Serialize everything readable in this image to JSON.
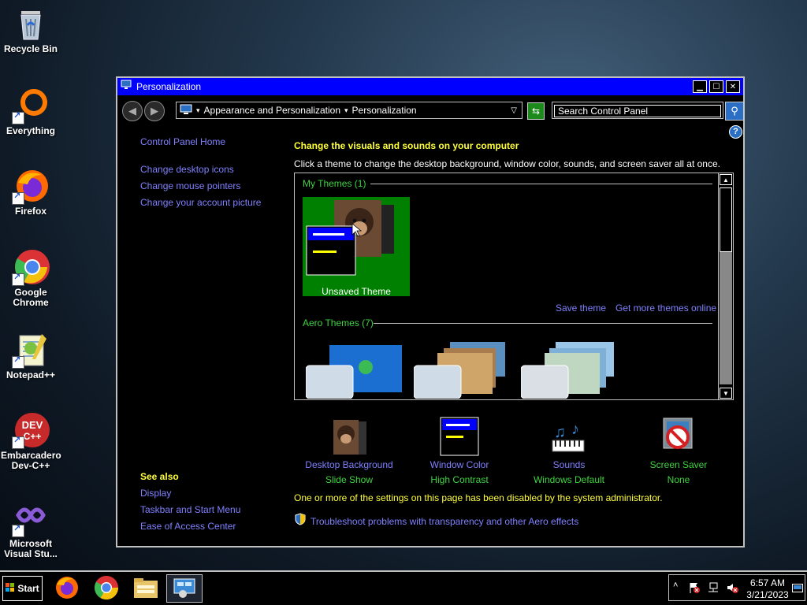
{
  "desktop": {
    "icons": [
      {
        "label": "Recycle Bin"
      },
      {
        "label": "Everything"
      },
      {
        "label": "Firefox"
      },
      {
        "label": "Google Chrome"
      },
      {
        "label": "Notepad++"
      },
      {
        "label": "Embarcadero Dev-C++"
      },
      {
        "label": "Microsoft Visual Stu..."
      }
    ]
  },
  "window": {
    "title": "Personalization",
    "address": {
      "crumb1": "Appearance and Personalization",
      "crumb2": "Personalization"
    },
    "search_placeholder": "Search Control Panel",
    "sidebar": {
      "home": "Control Panel Home",
      "links": [
        "Change desktop icons",
        "Change mouse pointers",
        "Change your account picture"
      ],
      "see_also_title": "See also",
      "see_also": [
        "Display",
        "Taskbar and Start Menu",
        "Ease of Access Center"
      ]
    },
    "main": {
      "heading": "Change the visuals and sounds on your computer",
      "subheading": "Click a theme to change the desktop background, window color, sounds, and screen saver all at once.",
      "my_themes": "My Themes (1)",
      "unsaved_theme": "Unsaved Theme",
      "save_theme": "Save theme",
      "get_more": "Get more themes online",
      "aero_themes": "Aero Themes (7)"
    },
    "settings": [
      {
        "label": "Desktop Background",
        "value": "Slide Show"
      },
      {
        "label": "Window Color",
        "value": "High Contrast"
      },
      {
        "label": "Sounds",
        "value": "Windows Default"
      },
      {
        "label": "Screen Saver",
        "value": "None"
      }
    ],
    "disabled_note": "One or more of the settings on this page has been disabled by the system administrator.",
    "troubleshoot": "Troubleshoot problems with transparency and other Aero effects"
  },
  "taskbar": {
    "start": "Start",
    "time": "6:57 AM",
    "date": "3/21/2023"
  }
}
